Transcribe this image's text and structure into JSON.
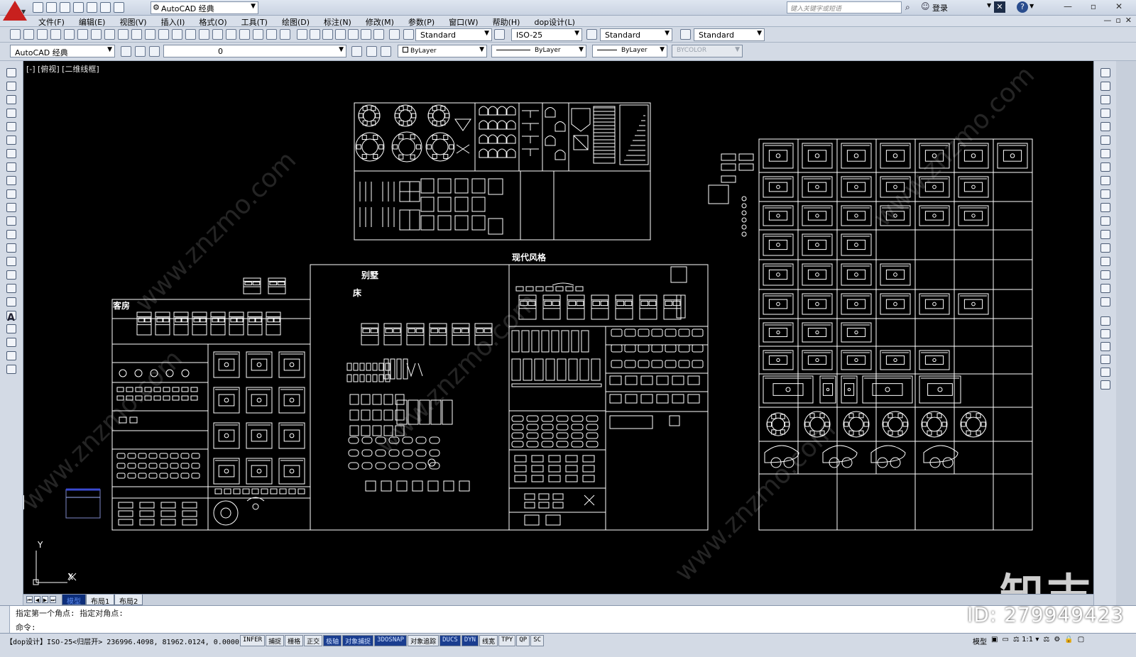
{
  "titlebar": {
    "workspace": "AutoCAD 经典",
    "search_placeholder": "键入关键字或短语",
    "login": "登录",
    "help": "?",
    "window_buttons": [
      "—",
      "▫",
      "✕"
    ]
  },
  "menus": [
    "文件(F)",
    "编辑(E)",
    "视图(V)",
    "插入(I)",
    "格式(O)",
    "工具(T)",
    "绘图(D)",
    "标注(N)",
    "修改(M)",
    "参数(P)",
    "窗口(W)",
    "帮助(H)",
    "dop设计(L)"
  ],
  "child_window_buttons": [
    "—",
    "▫",
    "✕"
  ],
  "styles_toolbar": {
    "text_style": "Standard",
    "dim_style": "ISO-25",
    "table_style": "Standard",
    "mleader_style": "Standard"
  },
  "layers_toolbar": {
    "workspace": "AutoCAD 经典",
    "layer": "0",
    "color": "ByLayer",
    "linetype": "ByLayer",
    "lineweight": "ByLayer",
    "plotstyle": "BYCOLOR"
  },
  "canvas": {
    "view_label": "[-] [俯视] [二维线框]",
    "ucs_x": "X",
    "ucs_y": "Y",
    "labels": {
      "guest_room": "客房",
      "villa": "别墅",
      "bed": "床",
      "modern": "现代风格"
    }
  },
  "tabs": [
    "模型",
    "布局1",
    "布局2"
  ],
  "command": {
    "history": "指定第一个角点: 指定对角点:",
    "prompt": "命令:"
  },
  "status": {
    "prefix": "【dop设计】ISO-25<归层开>",
    "coords": "236996.4098, 81962.0124, 0.0000",
    "toggles": [
      "INFER",
      "捕捉",
      "栅格",
      "正交",
      "极轴",
      "对象捕捉",
      "3DOSNAP",
      "对象追踪",
      "DUCS",
      "DYN",
      "线宽",
      "TPY",
      "QP",
      "SC"
    ],
    "active_toggles": [
      "极轴",
      "对象捕捉",
      "3DOSNAP",
      "DUCS",
      "DYN"
    ],
    "model": "模型",
    "scale": "1:1"
  },
  "watermark": {
    "id": "ID: 279949423",
    "brand": "知末",
    "site": "www.znzmo.com"
  },
  "colors": {
    "canvas": "#000000",
    "line": "#ffffff",
    "active_tab": "#0d2e7a"
  }
}
